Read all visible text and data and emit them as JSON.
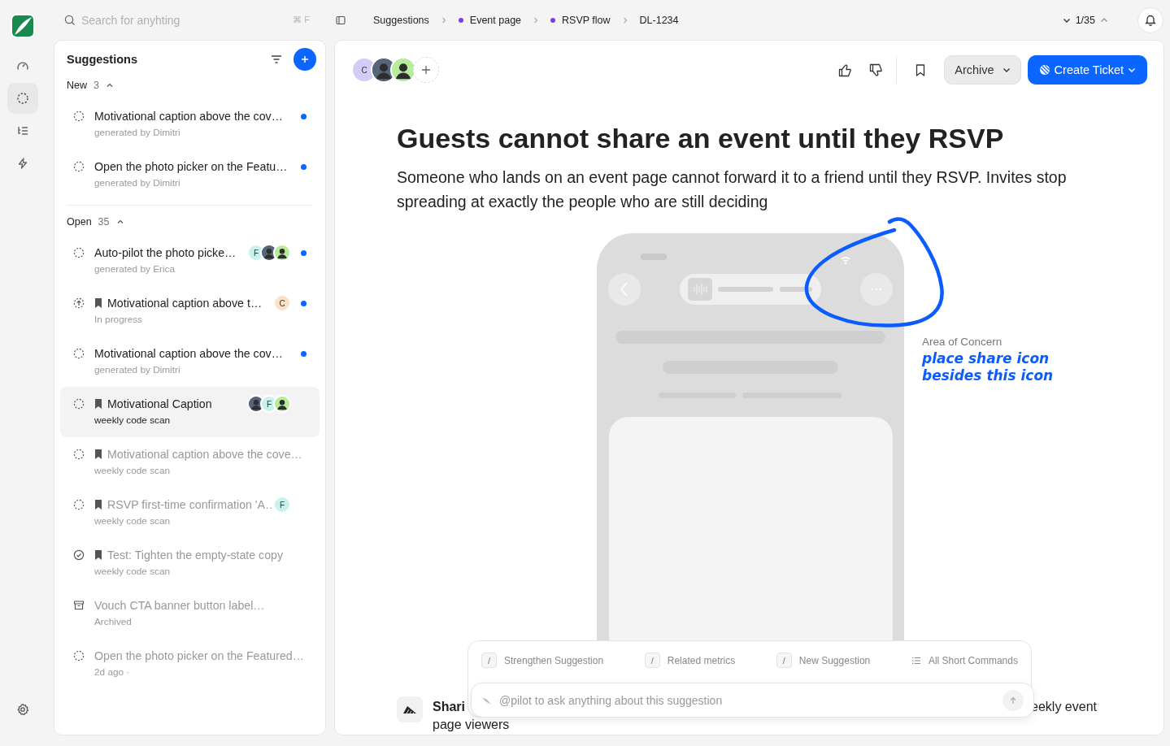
{
  "rail": [
    {
      "kind": "dashboard",
      "selected": false
    },
    {
      "kind": "suggestions",
      "selected": true
    },
    {
      "kind": "list",
      "selected": false
    },
    {
      "kind": "automation",
      "selected": false
    },
    {
      "kind": "settings",
      "selected": false
    }
  ],
  "search": {
    "placeholder": "Search for anyhting",
    "shortcut": "⌘ F"
  },
  "suggestions": {
    "title": "Suggestions",
    "groups": [
      {
        "label": "New",
        "count": "3",
        "expanded": true,
        "items": [
          {
            "kind": "open",
            "bookmarked": false,
            "title": "Motivational caption above the cov…",
            "subtitle": "generated by Dimitri",
            "unread": true,
            "muted": false,
            "selected": false
          },
          {
            "kind": "open",
            "bookmarked": false,
            "title": "Open the photo picker on the Featu…",
            "subtitle": "generated by Dimitri",
            "unread": true,
            "muted": false,
            "selected": false
          }
        ]
      },
      {
        "label": "Open",
        "count": "35",
        "expanded": true,
        "items": [
          {
            "kind": "open",
            "bookmarked": false,
            "title": "Auto-pilot the photo picke…",
            "subtitle": "generated by Erica",
            "avatars": [
              {
                "kind": "letter",
                "letter": "F",
                "color": "#c9f2ee"
              },
              {
                "kind": "photo",
                "color": "#56657a"
              },
              {
                "kind": "photo",
                "color": "#b6ec9c"
              }
            ],
            "unread": true,
            "muted": false,
            "selected": false
          },
          {
            "kind": "in_progress",
            "bookmarked": true,
            "title": "Motivational caption above t…",
            "subtitle": "In progress",
            "avatars": [
              {
                "kind": "letter",
                "letter": "C",
                "color": "#fde0c6"
              }
            ],
            "unread": true,
            "muted": false,
            "selected": false
          },
          {
            "kind": "open",
            "bookmarked": false,
            "title": "Motivational caption above the cov…",
            "subtitle": "generated by Dimitri",
            "unread": true,
            "muted": false,
            "selected": false
          },
          {
            "kind": "open",
            "bookmarked": true,
            "title": "Motivational Caption",
            "subtitle": "weekly code scan",
            "avatars": [
              {
                "kind": "photo",
                "color": "#56657a"
              },
              {
                "kind": "letter",
                "letter": "F",
                "color": "#c9f2ee"
              },
              {
                "kind": "photo",
                "color": "#b6ec9c"
              }
            ],
            "unread": false,
            "muted": false,
            "selected": true
          },
          {
            "kind": "open",
            "bookmarked": true,
            "title": "Motivational caption above the cove…",
            "subtitle": "weekly code scan",
            "unread": false,
            "muted": true,
            "selected": false
          },
          {
            "kind": "open",
            "bookmarked": true,
            "title": "RSVP first-time confirmation 'A…",
            "subtitle": "weekly code scan",
            "avatars": [
              {
                "kind": "letter",
                "letter": "F",
                "color": "#c9f2ee"
              }
            ],
            "unread": false,
            "muted": true,
            "selected": false
          },
          {
            "kind": "done",
            "bookmarked": true,
            "title": "Test: Tighten the empty-state copy",
            "subtitle": "weekly code scan",
            "unread": false,
            "muted": true,
            "selected": false
          },
          {
            "kind": "archived",
            "bookmarked": false,
            "title": "Vouch CTA banner button label…",
            "subtitle": "Archived",
            "unread": false,
            "muted": true,
            "selected": false
          },
          {
            "kind": "open",
            "bookmarked": false,
            "title": "Open the photo picker on the Featured…",
            "subtitle": "2d ago ·",
            "unread": false,
            "muted": true,
            "selected": false
          }
        ]
      }
    ]
  },
  "breadcrumb": [
    {
      "label": "Suggestions",
      "dot": false
    },
    {
      "label": "Event page",
      "dot": true
    },
    {
      "label": "RSVP flow",
      "dot": true
    },
    {
      "label": "DL-1234",
      "dot": false
    }
  ],
  "pager": "1/35",
  "collaborators": [
    {
      "kind": "letter",
      "letter": "C",
      "color": "#d2cdf6"
    },
    {
      "kind": "photo",
      "color": "#56657a"
    },
    {
      "kind": "photo",
      "color": "#b6ec9c"
    }
  ],
  "actions": {
    "archive": "Archive",
    "create": "Create Ticket"
  },
  "article": {
    "title": "Guests cannot share an event until they RSVP",
    "body": "Someone who lands on an event page cannot forward it to a friend until they RSVP. Invites stop spreading at exactly the people who are still deciding",
    "annotation": {
      "label": "Area of Concern",
      "note": "place share icon besides this icon"
    },
    "next_section": {
      "title_start": "Shari",
      "title_end": "eekly event",
      "continuation": "page viewers"
    }
  },
  "commands": [
    {
      "kind": "slash",
      "key": "/",
      "label": "Strengthen Suggestion"
    },
    {
      "kind": "slash",
      "key": "/",
      "label": "Related metrics"
    },
    {
      "kind": "slash",
      "key": "/",
      "label": "New Suggestion"
    },
    {
      "kind": "list",
      "label": "All Short Commands"
    }
  ],
  "composer": {
    "placeholder": "@pilot to ask anything about this suggestion"
  }
}
